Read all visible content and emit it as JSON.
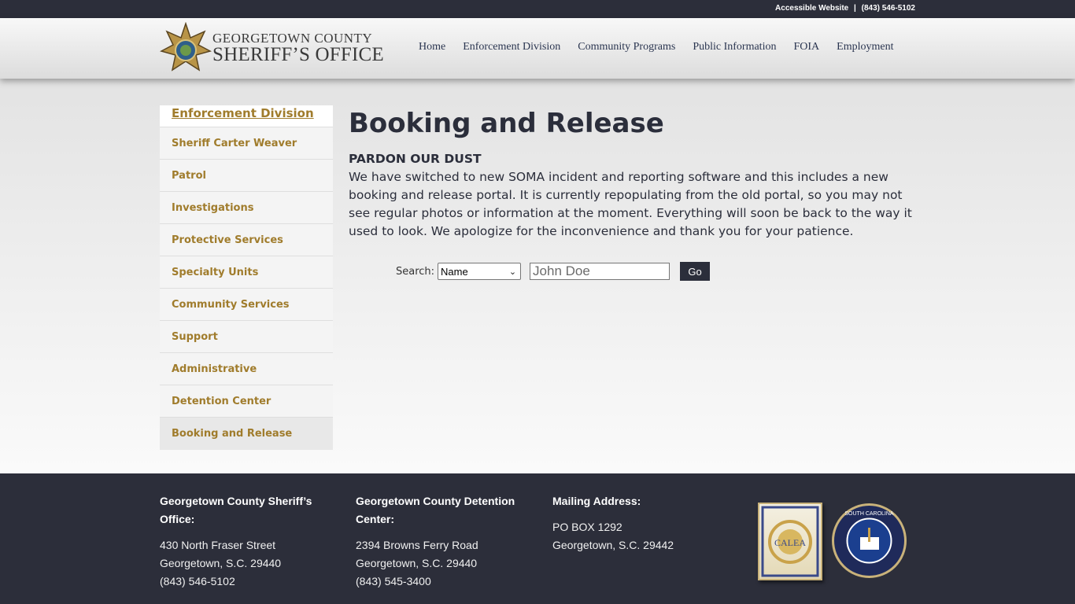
{
  "topbar": {
    "accessible_link": "Accessible Website",
    "separator": "|",
    "phone": "(843) 546-5102"
  },
  "header": {
    "logo_line1": "GEORGETOWN COUNTY",
    "logo_line2": "SHERIFF’S OFFICE",
    "nav": [
      "Home",
      "Enforcement Division",
      "Community Programs",
      "Public Information",
      "FOIA",
      "Employment"
    ]
  },
  "sidebar": {
    "heading": "Enforcement Division",
    "items": [
      {
        "label": "Sheriff Carter Weaver"
      },
      {
        "label": "Patrol"
      },
      {
        "label": "Investigations"
      },
      {
        "label": "Protective Services"
      },
      {
        "label": "Specialty Units"
      },
      {
        "label": "Community Services"
      },
      {
        "label": "Support"
      },
      {
        "label": "Administrative"
      },
      {
        "label": "Detention Center"
      },
      {
        "label": "Booking and Release",
        "active": true
      }
    ]
  },
  "main": {
    "title": "Booking and Release",
    "notice_heading": "PARDON OUR DUST",
    "notice_body": "We have switched to new SOMA incident and reporting software and this includes a new booking and release portal. It is currently repopulating from the old portal, so you may not see regular photos or information at the moment. Everything will soon be back to the way it used to look. We apologize for the inconvenience and thank you for your patience."
  },
  "search": {
    "label": "Search:",
    "selected_option": "Name",
    "placeholder": "John Doe",
    "button_label": "Go"
  },
  "footer": {
    "office": {
      "heading": "Georgetown County Sheriff’s Office:",
      "line1": "430 North Fraser Street",
      "line2": "Georgetown, S.C. 29440",
      "line3": "(843) 546-5102"
    },
    "detention": {
      "heading": "Georgetown County Detention Center:",
      "line1": "2394 Browns Ferry Road",
      "line2": "Georgetown, S.C. 29440",
      "line3": "(843) 545-3400"
    },
    "mailing": {
      "heading": "Mailing Address:",
      "line1": "PO BOX 1292",
      "line2": "Georgetown, S.C. 29442"
    },
    "badge_calea_text": "CALEA",
    "badge_sc_text": "SOUTH CAROLINA"
  },
  "colors": {
    "dark": "#2c2e3a",
    "gold": "#a07c2c",
    "text": "#2b2e3b"
  }
}
